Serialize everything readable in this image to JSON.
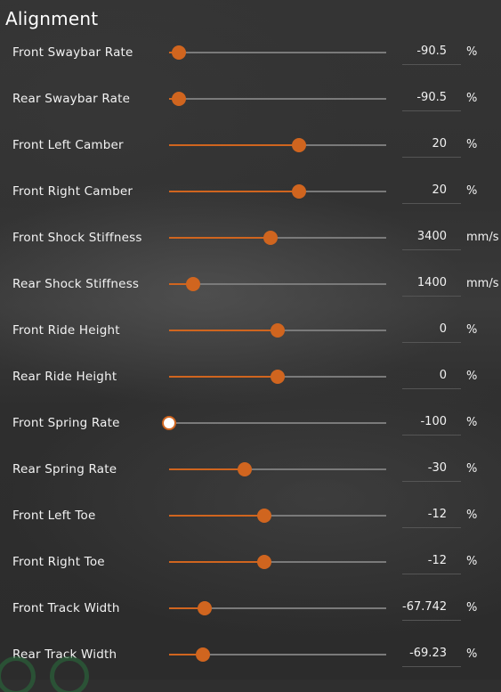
{
  "panel": {
    "title": "Alignment"
  },
  "colors": {
    "accent": "#d0651f",
    "track": "#7a7a7a",
    "text": "#ffffff"
  },
  "rows": [
    {
      "label": "Front Swaybar Rate",
      "value": "-90.5",
      "unit": "%",
      "fraction": 0.047
    },
    {
      "label": "Rear Swaybar Rate",
      "value": "-90.5",
      "unit": "%",
      "fraction": 0.047
    },
    {
      "label": "Front Left Camber",
      "value": "20",
      "unit": "%",
      "fraction": 0.6
    },
    {
      "label": "Front Right Camber",
      "value": "20",
      "unit": "%",
      "fraction": 0.6
    },
    {
      "label": "Front Shock Stiffness",
      "value": "3400",
      "unit": "mm/s",
      "fraction": 0.467
    },
    {
      "label": "Rear Shock Stiffness",
      "value": "1400",
      "unit": "mm/s",
      "fraction": 0.109
    },
    {
      "label": "Front Ride Height",
      "value": "0",
      "unit": "%",
      "fraction": 0.5
    },
    {
      "label": "Rear Ride Height",
      "value": "0",
      "unit": "%",
      "fraction": 0.5
    },
    {
      "label": "Front Spring Rate",
      "value": "-100",
      "unit": "%",
      "fraction": 0.0
    },
    {
      "label": "Rear Spring Rate",
      "value": "-30",
      "unit": "%",
      "fraction": 0.35
    },
    {
      "label": "Front Left Toe",
      "value": "-12",
      "unit": "%",
      "fraction": 0.44
    },
    {
      "label": "Front Right Toe",
      "value": "-12",
      "unit": "%",
      "fraction": 0.44
    },
    {
      "label": "Front Track Width",
      "value": "-67.742",
      "unit": "%",
      "fraction": 0.164
    },
    {
      "label": "Rear Track Width",
      "value": "-69.23",
      "unit": "%",
      "fraction": 0.156
    }
  ]
}
